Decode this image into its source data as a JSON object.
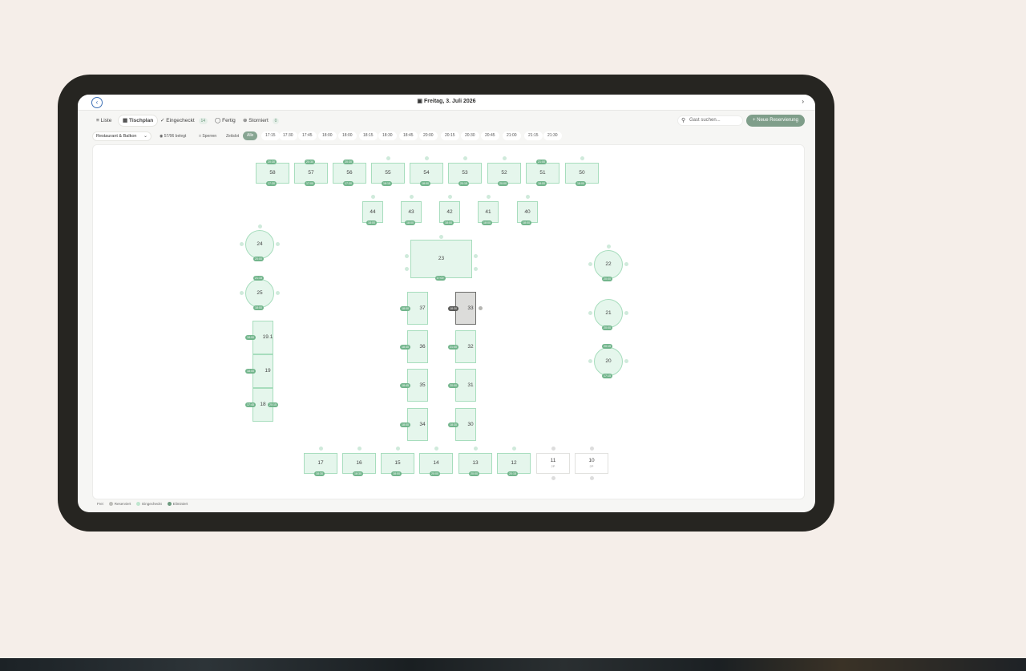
{
  "header": {
    "date": "Freitag, 3. Juli 2026"
  },
  "tabs": [
    {
      "label": "Liste",
      "icon": "list-icon",
      "active": false
    },
    {
      "label": "Tischplan",
      "icon": "grid-icon",
      "active": true
    },
    {
      "label": "Eingecheckt",
      "icon": "check-icon",
      "badge": "14",
      "active": false
    },
    {
      "label": "Fertig",
      "icon": "check-circle-icon",
      "active": false
    },
    {
      "label": "Storniert",
      "icon": "cancel-icon",
      "badge": "0",
      "active": false
    }
  ],
  "search": {
    "placeholder": "Gast suchen..."
  },
  "new_reservation": {
    "label": "Neue Reservierung"
  },
  "filters": {
    "area": "Restaurant & Balkon",
    "occupancy": "57/96 belegt",
    "block": "Sperren",
    "time_label": "Zeitslot",
    "slots": [
      "Alle",
      "17:15",
      "17:30",
      "17:45",
      "18:00",
      "18:00",
      "18:15",
      "18:30",
      "18:45",
      "20:00",
      "20:15",
      "20:30",
      "20:45",
      "21:00",
      "21:15",
      "21:30"
    ],
    "active_slot": "Alle"
  },
  "legend": [
    {
      "label": "Frei",
      "color": ""
    },
    {
      "label": "Reserviert",
      "color": "#bdbdb9"
    },
    {
      "label": "Eingecheckt",
      "color": "#bfe6cf"
    },
    {
      "label": "Eliminiert",
      "color": "#6d9a7f"
    }
  ],
  "tables": [
    {
      "id": "58",
      "label": "58",
      "times": [
        "20:30",
        "17:30"
      ]
    },
    {
      "id": "57",
      "label": "57",
      "times": [
        "20:30",
        "17:00"
      ]
    },
    {
      "id": "56",
      "label": "56",
      "times": [
        "20:30",
        "17:30"
      ]
    },
    {
      "id": "55",
      "label": "55",
      "times": [
        "18:15"
      ]
    },
    {
      "id": "54",
      "label": "54",
      "times": [
        "18:00"
      ]
    },
    {
      "id": "53",
      "label": "53",
      "times": [
        "20:15"
      ]
    },
    {
      "id": "52",
      "label": "52",
      "times": [
        "20:00"
      ]
    },
    {
      "id": "51",
      "label": "51",
      "times": [
        "21:00",
        "18:00"
      ]
    },
    {
      "id": "50",
      "label": "50",
      "times": [
        "18:00"
      ]
    },
    {
      "id": "44",
      "label": "44",
      "times": [
        "18:00"
      ]
    },
    {
      "id": "43",
      "label": "43",
      "times": [
        "18:00"
      ]
    },
    {
      "id": "42",
      "label": "42",
      "times": [
        "18:00"
      ]
    },
    {
      "id": "41",
      "label": "41",
      "times": [
        "18:00"
      ]
    },
    {
      "id": "40",
      "label": "40",
      "times": [
        "18:00"
      ]
    },
    {
      "id": "24",
      "label": "24",
      "times": [
        "20:00"
      ]
    },
    {
      "id": "23",
      "label": "23",
      "times": [
        "17:00"
      ]
    },
    {
      "id": "25",
      "label": "25",
      "times": [
        "21:15",
        "18:00"
      ]
    },
    {
      "id": "22",
      "label": "22",
      "times": [
        "20:00"
      ]
    },
    {
      "id": "21",
      "label": "21",
      "times": [
        "20:00"
      ]
    },
    {
      "id": "20",
      "label": "20",
      "times": [
        "20:15",
        "17:15"
      ]
    },
    {
      "id": "37",
      "label": "37",
      "times": [
        "18:00"
      ]
    },
    {
      "id": "33",
      "label": "33",
      "times": [
        "18:30"
      ]
    },
    {
      "id": "36",
      "label": "36",
      "times": [
        "18:30"
      ]
    },
    {
      "id": "32",
      "label": "32",
      "times": [
        "21:00"
      ]
    },
    {
      "id": "35",
      "label": "35",
      "times": [
        "18:45"
      ]
    },
    {
      "id": "31",
      "label": "31",
      "times": [
        "20:00"
      ]
    },
    {
      "id": "34",
      "label": "34",
      "times": [
        "18:00"
      ]
    },
    {
      "id": "30",
      "label": "30",
      "times": [
        "18:30"
      ]
    },
    {
      "id": "19.1",
      "label": "19.1",
      "times": [
        "18:00"
      ]
    },
    {
      "id": "19",
      "label": "19",
      "times": [
        "18:00"
      ]
    },
    {
      "id": "18",
      "label": "18",
      "times": [
        "17:45",
        "20:15"
      ]
    },
    {
      "id": "17",
      "label": "17",
      "times": [
        "18:30"
      ]
    },
    {
      "id": "16",
      "label": "16",
      "times": [
        "18:30"
      ]
    },
    {
      "id": "15",
      "label": "15",
      "times": [
        "18:00"
      ]
    },
    {
      "id": "14",
      "label": "14",
      "times": [
        "20:00"
      ]
    },
    {
      "id": "13",
      "label": "13",
      "times": [
        "20:00"
      ]
    },
    {
      "id": "12",
      "label": "12",
      "times": [
        "20:15"
      ]
    },
    {
      "id": "11",
      "label": "11",
      "sub": "2P",
      "times": []
    },
    {
      "id": "10",
      "label": "10",
      "sub": "2P",
      "times": []
    }
  ]
}
